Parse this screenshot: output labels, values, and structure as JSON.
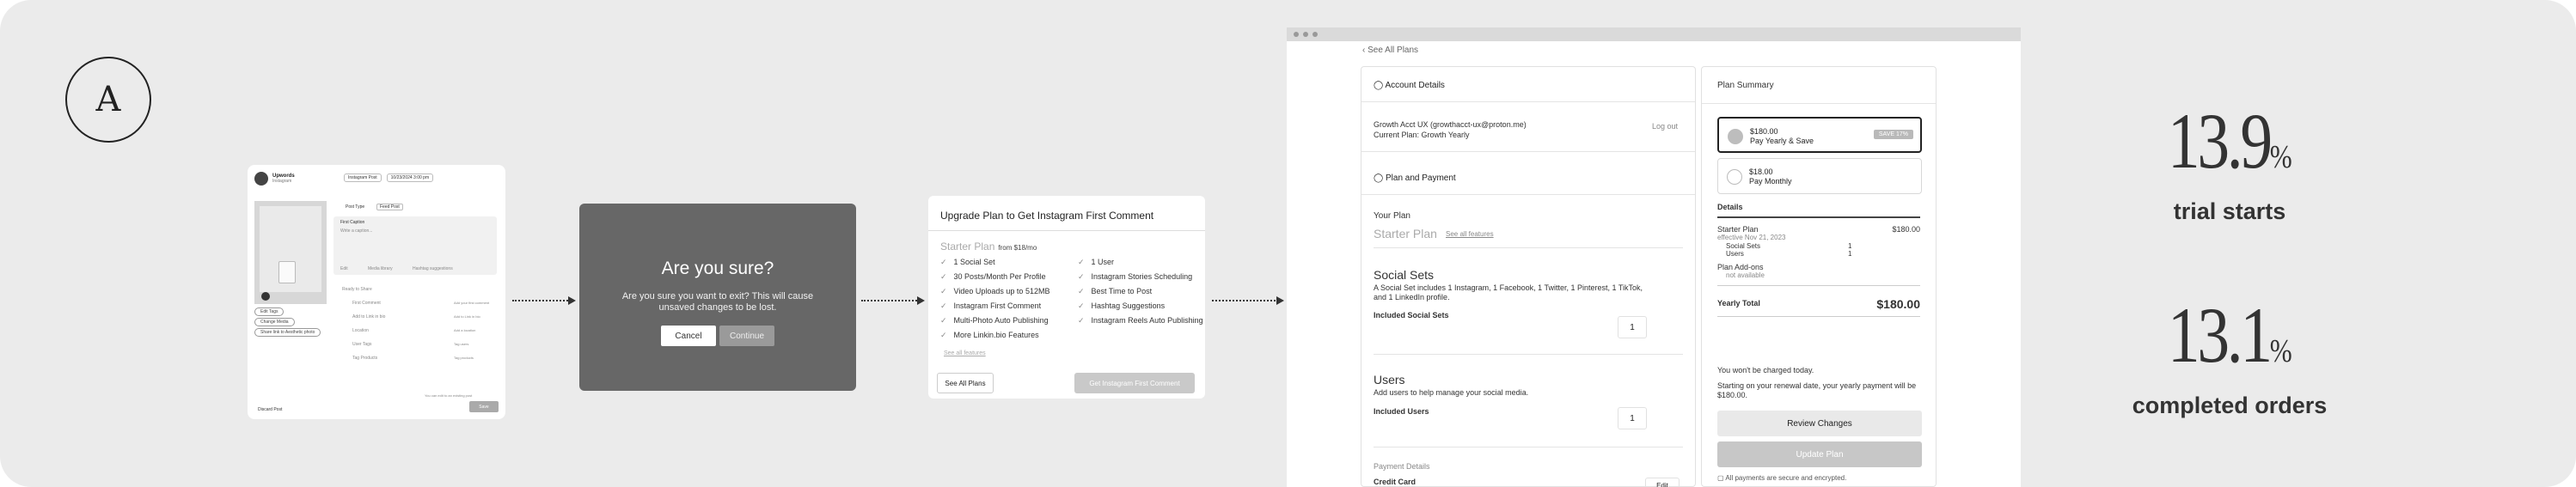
{
  "brand": {
    "logo_letter": "A"
  },
  "screen1": {
    "account_name": "Upwords",
    "account_platform": "Instagram",
    "post_type_pill": "Instagram Post",
    "date_pill": "10/23/2024 3:00 pm",
    "post_type_label": "Post Type",
    "post_type_value": "Feed Post",
    "caption_label": "First Caption",
    "caption_placeholder": "Write a caption...",
    "chips": [
      "Edit Tags",
      "Change Media",
      "Share link to Aesthetic photo"
    ],
    "media_links": [
      "Edit",
      "Media library",
      "Hashtag suggestions"
    ],
    "schedule_label": "Ready to Share",
    "rows": [
      "First Comment",
      "Add to Link in bio",
      "Location",
      "User Tags",
      "Tag Products"
    ],
    "row_hints": [
      "Add your first comment",
      "Add to Link in bio",
      "Add a location",
      "Tag users",
      "Tag products"
    ],
    "note": "You can edit to an existing post",
    "footer_left": "Discard Post",
    "post_button": "Save"
  },
  "screen2": {
    "title": "Are you sure?",
    "message": "Are you sure you want to exit? This will cause unsaved changes to be lost.",
    "cancel": "Cancel",
    "continue": "Continue"
  },
  "screen3": {
    "title": "Upgrade Plan to Get Instagram First Comment",
    "plan_name": "Starter Plan",
    "plan_price": "from $18/mo",
    "features_left": [
      "1 Social Set",
      "30 Posts/Month Per Profile",
      "Video Uploads up to 512MB",
      "Instagram First Comment",
      "Multi-Photo Auto Publishing",
      "More Linkin.bio Features"
    ],
    "features_right": [
      "1 User",
      "Instagram Stories Scheduling",
      "Best Time to Post",
      "Hashtag Suggestions",
      "Instagram Reels Auto Publishing"
    ],
    "see_all": "See all features",
    "see_all_plans": "See All Plans",
    "cta": "Get Instagram First Comment"
  },
  "screen4": {
    "back": "See All Plans",
    "account_details": "Account Details",
    "account_line1": "Growth Acct UX (growthacct-ux@proton.me)",
    "account_line2": "Current Plan: Growth Yearly",
    "logout": "Log out",
    "plan_and_payment": "Plan and Payment",
    "your_plan": "Your Plan",
    "plan_name": "Starter Plan",
    "see_all_features": "See all features",
    "social_sets_title": "Social Sets",
    "social_sets_desc": "A Social Set includes 1 Instagram, 1 Facebook, 1 Twitter, 1 Pinterest, 1 TikTok, and 1 LinkedIn profile.",
    "included_social_sets": "Included Social Sets",
    "social_sets_qty": "1",
    "users_title": "Users",
    "users_desc": "Add users to help manage your social media.",
    "included_users": "Included Users",
    "users_qty": "1",
    "payment_details": "Payment Details",
    "credit_card": "Credit Card",
    "edit": "Edit",
    "summary_title": "Plan Summary",
    "option1_price": "$180.00",
    "option1_label": "Pay Yearly & Save",
    "option1_badge": "SAVE 17%",
    "option2_price": "$18.00",
    "option2_label": "Pay Monthly",
    "details": "Details",
    "detail_plan": "Starter Plan",
    "detail_plan_price": "$180.00",
    "detail_effective": "effective Nov 21, 2023",
    "detail_social_sets": "Social Sets",
    "detail_social_sets_qty": "1",
    "detail_users": "Users",
    "detail_users_qty": "1",
    "addons": "Plan Add-ons",
    "addons_value": "not available",
    "yearly_total": "Yearly Total",
    "yearly_total_value": "$180.00",
    "not_charged": "You won't be charged today.",
    "renewal": "Starting on your renewal date, your yearly payment will be $180.00.",
    "review_changes": "Review Changes",
    "update_plan": "Update Plan",
    "secure": "All payments are secure and encrypted."
  },
  "stats": [
    {
      "value": "13.9",
      "unit": "%",
      "caption": "trial starts"
    },
    {
      "value": "13.1",
      "unit": "%",
      "caption": "completed orders"
    }
  ]
}
